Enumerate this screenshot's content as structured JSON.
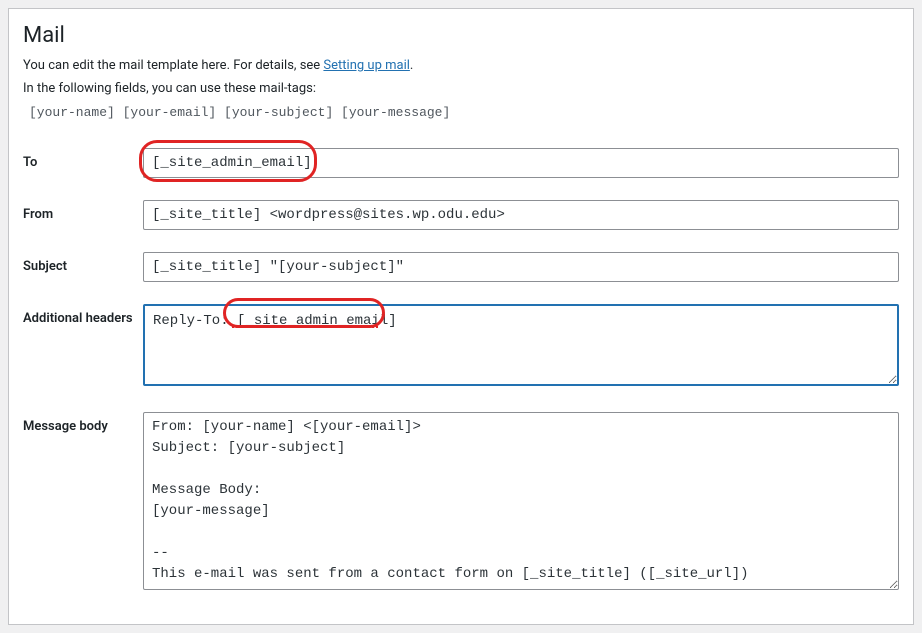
{
  "section": {
    "title": "Mail",
    "intro_prefix": "You can edit the mail template here. For details, see ",
    "intro_link": "Setting up mail",
    "intro_suffix": ".",
    "intro2": "In the following fields, you can use these mail-tags:",
    "mailtags": "[your-name] [your-email] [your-subject] [your-message]"
  },
  "fields": {
    "to": {
      "label": "To",
      "value": "[_site_admin_email]"
    },
    "from": {
      "label": "From",
      "value": "[_site_title] <wordpress@sites.wp.odu.edu>"
    },
    "subject": {
      "label": "Subject",
      "value": "[_site_title] \"[your-subject]\""
    },
    "headers": {
      "label": "Additional headers",
      "value": "Reply-To: [_site_admin_email]"
    },
    "body": {
      "label": "Message body",
      "value": "From: [your-name] <[your-email]>\nSubject: [your-subject]\n\nMessage Body:\n[your-message]\n\n-- \nThis e-mail was sent from a contact form on [_site_title] ([_site_url])"
    }
  }
}
